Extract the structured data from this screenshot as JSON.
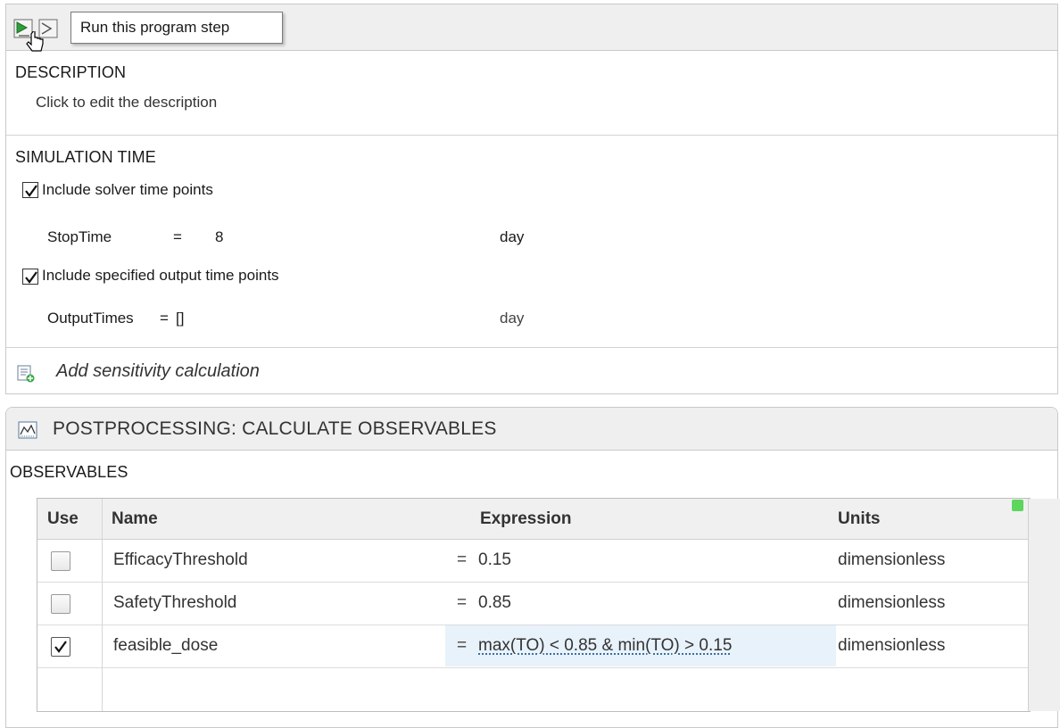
{
  "toolbar": {
    "tooltip": "Run this program step",
    "icons": [
      "run-step-icon",
      "step-icon",
      "hand-cursor-icon"
    ]
  },
  "description": {
    "title": "DESCRIPTION",
    "placeholder": "Click to edit the description"
  },
  "simulation_time": {
    "title": "SIMULATION TIME",
    "include_solver": {
      "label": "Include solver time points",
      "checked": true
    },
    "stop_time": {
      "name": "StopTime",
      "eq": "=",
      "value": "8",
      "units": "day"
    },
    "include_output": {
      "label": "Include specified output time points",
      "checked": true
    },
    "output_times": {
      "name": "OutputTimes",
      "eq": "=",
      "value": "[]",
      "units": "day"
    }
  },
  "sensitivity": {
    "label": "Add sensitivity calculation"
  },
  "postprocessing": {
    "title": "POSTPROCESSING: CALCULATE OBSERVABLES",
    "section": "OBSERVABLES",
    "columns": [
      "Use",
      "Name",
      "Expression",
      "Units"
    ],
    "rows": [
      {
        "use": false,
        "name": "EfficacyThreshold",
        "eq": "=",
        "expression": "0.15",
        "units": "dimensionless"
      },
      {
        "use": false,
        "name": "SafetyThreshold",
        "eq": "=",
        "expression": "0.85",
        "units": "dimensionless"
      },
      {
        "use": true,
        "name": "feasible_dose",
        "eq": "=",
        "expression": "max(TO) < 0.85 & min(TO) > 0.15",
        "units": "dimensionless"
      }
    ],
    "status_color": "#5cd65c"
  }
}
